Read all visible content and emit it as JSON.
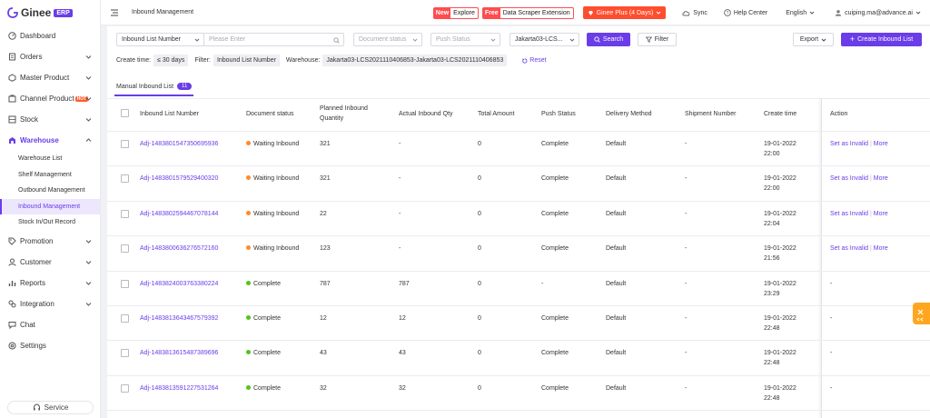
{
  "sidebar": {
    "brand": "Ginee",
    "brand_tag": "ERP",
    "items": [
      {
        "label": "Dashboard",
        "icon": "dashboard-icon"
      },
      {
        "label": "Orders",
        "icon": "orders-icon"
      },
      {
        "label": "Master Product",
        "icon": "product-icon"
      },
      {
        "label": "Channel Product",
        "icon": "channel-icon",
        "badge": "HOT"
      },
      {
        "label": "Stock",
        "icon": "stock-icon"
      },
      {
        "label": "Warehouse",
        "icon": "warehouse-icon"
      },
      {
        "label": "Promotion",
        "icon": "promotion-icon"
      },
      {
        "label": "Customer",
        "icon": "customer-icon"
      },
      {
        "label": "Reports",
        "icon": "reports-icon"
      },
      {
        "label": "Integration",
        "icon": "integration-icon"
      },
      {
        "label": "Chat",
        "icon": "chat-icon"
      },
      {
        "label": "Settings",
        "icon": "settings-icon"
      }
    ],
    "warehouse_sub": [
      "Warehouse List",
      "Shelf Management",
      "Outbound Management",
      "Inbound Management",
      "Stock In/Out Record"
    ],
    "service": "Service"
  },
  "topbar": {
    "title": "Inbound Management",
    "explore_tag": "New",
    "explore": "Explore",
    "scraper_tag": "Free",
    "scraper": "Data Scraper Extension",
    "plus": "Ginee Plus (4 Days)",
    "sync": "Sync",
    "help": "Help Center",
    "language": "English",
    "user": "cuiping.ma@advance.ai"
  },
  "search": {
    "field": "Inbound List Number",
    "placeholder": "Please Enter",
    "document_status": "Document status",
    "push_status": "Push Status",
    "warehouse": "Jakarta03-LCS...",
    "search_btn": "Search",
    "filter_btn": "Filter",
    "export_btn": "Export",
    "create_btn": "Create Inbound List"
  },
  "filters": {
    "create_time_label": "Create time:",
    "create_time": "≤ 30 days",
    "filter_label": "Filter:",
    "filter_value": "Inbound List Number",
    "warehouse_label": "Warehouse:",
    "warehouse_value": "Jakarta03-LCS2021110406853-Jakarta03-LCS2021110406853",
    "reset": "Reset"
  },
  "tab": {
    "label": "Manual Inbound List",
    "count": "11"
  },
  "columns": {
    "number": "Inbound List Number",
    "doc_status": "Document status",
    "planned": "Planned Inbound Quantity",
    "actual": "Actual Inbound Qty",
    "amount": "Total Amount",
    "push": "Push Status",
    "delivery": "Delivery Method",
    "shipment": "Shipment Number",
    "create_time": "Create time",
    "action": "Action"
  },
  "actions": {
    "invalid": "Set as Invalid",
    "sep": "|",
    "more": "More",
    "none": "-"
  },
  "colors": {
    "accent": "#6a3de8",
    "waiting": "#ff8a2a",
    "complete": "#52c41a"
  },
  "rows": [
    {
      "number": "Adj-1483801547350695936",
      "status": "Waiting Inbound",
      "planned": "321",
      "actual": "-",
      "amount": "0",
      "push": "Complete",
      "delivery": "Default",
      "shipment": "-",
      "date": "19-01-2022",
      "time": "22:00",
      "actionable": true
    },
    {
      "number": "Adj-1483801579529400320",
      "status": "Waiting Inbound",
      "planned": "321",
      "actual": "-",
      "amount": "0",
      "push": "Complete",
      "delivery": "Default",
      "shipment": "-",
      "date": "19-01-2022",
      "time": "22:00",
      "actionable": true
    },
    {
      "number": "Adj-1483802594467078144",
      "status": "Waiting Inbound",
      "planned": "22",
      "actual": "-",
      "amount": "0",
      "push": "Complete",
      "delivery": "Default",
      "shipment": "-",
      "date": "19-01-2022",
      "time": "22:04",
      "actionable": true
    },
    {
      "number": "Adj-1483800636276572160",
      "status": "Waiting Inbound",
      "planned": "123",
      "actual": "-",
      "amount": "0",
      "push": "Complete",
      "delivery": "Default",
      "shipment": "-",
      "date": "19-01-2022",
      "time": "21:56",
      "actionable": true
    },
    {
      "number": "Adj-1483824003763380224",
      "status": "Complete",
      "planned": "787",
      "actual": "787",
      "amount": "0",
      "push": "-",
      "delivery": "Default",
      "shipment": "-",
      "date": "19-01-2022",
      "time": "23:29",
      "actionable": false
    },
    {
      "number": "Adj-1483813643467579392",
      "status": "Complete",
      "planned": "12",
      "actual": "12",
      "amount": "0",
      "push": "Complete",
      "delivery": "Default",
      "shipment": "-",
      "date": "19-01-2022",
      "time": "22:48",
      "actionable": false
    },
    {
      "number": "Adj-1483813615487389696",
      "status": "Complete",
      "planned": "43",
      "actual": "43",
      "amount": "0",
      "push": "Complete",
      "delivery": "Default",
      "shipment": "-",
      "date": "19-01-2022",
      "time": "22:48",
      "actionable": false
    },
    {
      "number": "Adj-1483813591227531264",
      "status": "Complete",
      "planned": "32",
      "actual": "32",
      "amount": "0",
      "push": "Complete",
      "delivery": "Default",
      "shipment": "-",
      "date": "19-01-2022",
      "time": "22:48",
      "actionable": false
    }
  ]
}
